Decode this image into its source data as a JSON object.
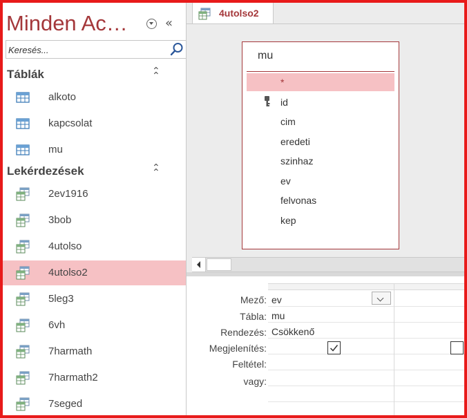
{
  "nav": {
    "title": "Minden Ac…",
    "search_placeholder": "Keresés...",
    "sections": [
      {
        "label": "Táblák",
        "items": [
          "alkoto",
          "kapcsolat",
          "mu"
        ]
      },
      {
        "label": "Lekérdezések",
        "items": [
          "2ev1916",
          "3bob",
          "4utolso",
          "4utolso2",
          "5leg3",
          "6vh",
          "7harmath",
          "7harmath2",
          "7seged"
        ]
      }
    ],
    "selected_item": "4utolso2"
  },
  "tab": {
    "label": "4utolso2"
  },
  "table_box": {
    "title": "mu",
    "fields": [
      "*",
      "id",
      "cim",
      "eredeti",
      "szinhaz",
      "ev",
      "felvonas",
      "kep"
    ],
    "primary_key": "id"
  },
  "grid": {
    "row_labels": [
      "Mező:",
      "Tábla:",
      "Rendezés:",
      "Megjelenítés:",
      "Feltétel:",
      "vagy:"
    ],
    "columns": [
      {
        "field": "ev",
        "table": "mu",
        "sort": "Csökkenő",
        "show": true
      },
      {
        "field": "",
        "table": "",
        "sort": "",
        "show": false
      }
    ]
  },
  "colors": {
    "accent": "#a4373a",
    "selected_bg": "#f6c1c4",
    "frame": "#e81a1a"
  }
}
